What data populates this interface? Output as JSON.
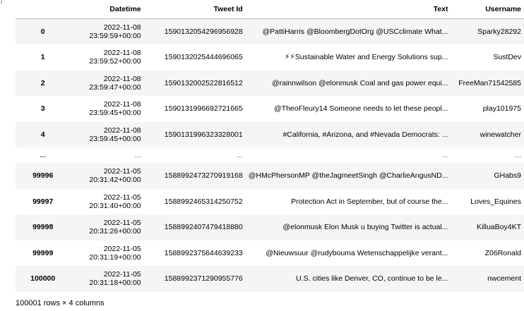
{
  "corner_glyph": "ƒ",
  "table": {
    "columns": [
      "Datetime",
      "Tweet Id",
      "Text",
      "Username"
    ],
    "rows": [
      {
        "index": "0",
        "date": "2022-11-08",
        "time": "23:59:59+00:00",
        "tweet_id": "1590132054296956928",
        "text": "@PattiHarris @BloombergDotOrg @USCclimate What...",
        "username": "Sparky28292"
      },
      {
        "index": "1",
        "date": "2022-11-08",
        "time": "23:59:52+00:00",
        "tweet_id": "1590132025444696065",
        "text": "⚡⚡Sustainable Water and Energy Solutions sup...",
        "username": "SustDev"
      },
      {
        "index": "2",
        "date": "2022-11-08",
        "time": "23:59:47+00:00",
        "tweet_id": "1590132002522816512",
        "text": "@rainnwilson @elonmusk Coal and gas power equi...",
        "username": "FreeMan71542585"
      },
      {
        "index": "3",
        "date": "2022-11-08",
        "time": "23:59:45+00:00",
        "tweet_id": "1590131996692721665",
        "text": "@TheoFleury14 Someone needs to let these peopl...",
        "username": "play101975"
      },
      {
        "index": "4",
        "date": "2022-11-08",
        "time": "23:59:45+00:00",
        "tweet_id": "1590131996323328001",
        "text": "#California, #Arizona, and #Nevada Democrats: ...",
        "username": "winewatcher"
      },
      {
        "index": "99996",
        "date": "2022-11-05",
        "time": "20:31:42+00:00",
        "tweet_id": "1588992473270919168",
        "text": "@HMcPhersonMP @theJagmeetSingh @CharlieAngusND...",
        "username": "GHabs9"
      },
      {
        "index": "99997",
        "date": "2022-11-05",
        "time": "20:31:40+00:00",
        "tweet_id": "1588992465314250752",
        "text": "Protection Act in September, but of course the...",
        "username": "Loves_Equines"
      },
      {
        "index": "99998",
        "date": "2022-11-05",
        "time": "20:31:26+00:00",
        "tweet_id": "1588992407479418880",
        "text": "@elonmusk Elon Musk u buying Twitter is actual...",
        "username": "KilluaBoy4KT"
      },
      {
        "index": "99999",
        "date": "2022-11-05",
        "time": "20:31:19+00:00",
        "tweet_id": "1588992375644639233",
        "text": "@Nieuwsuur @rudybouma Wetenschappelijke verant...",
        "username": "Z06Ronald"
      },
      {
        "index": "100000",
        "date": "2022-11-05",
        "time": "20:31:18+00:00",
        "tweet_id": "1588992371290955776",
        "text": "U.S. cities like Denver, CO, continue to be le...",
        "username": "nwcement"
      }
    ],
    "ellipsis": "..."
  },
  "footer": "100001 rows × 4 columns"
}
